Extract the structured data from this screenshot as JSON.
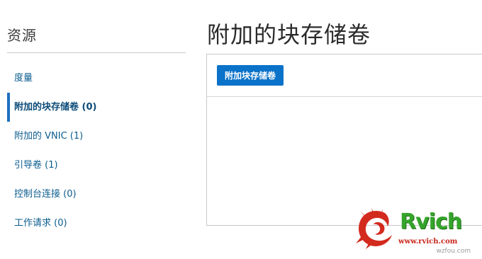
{
  "sidebar": {
    "title": "资源",
    "items": [
      {
        "label": "度量",
        "active": false
      },
      {
        "label": "附加的块存储卷 (0)",
        "active": true
      },
      {
        "label": "附加的 VNIC (1)",
        "active": false
      },
      {
        "label": "引导卷 (1)",
        "active": false
      },
      {
        "label": "控制台连接 (0)",
        "active": false
      },
      {
        "label": "工作请求 (0)",
        "active": false
      }
    ]
  },
  "main": {
    "title": "附加的块存储卷",
    "attach_button_label": "附加块存储卷"
  },
  "watermark": {
    "brand": "Rvich",
    "site": "www.rvich.com",
    "corner": "wzfou.com"
  },
  "colors": {
    "accent": "#0a72c9",
    "link": "#0b5c8e",
    "active_indicator": "#1e6fbf",
    "watermark_green": "#35a42b",
    "watermark_red": "#c8271d"
  }
}
